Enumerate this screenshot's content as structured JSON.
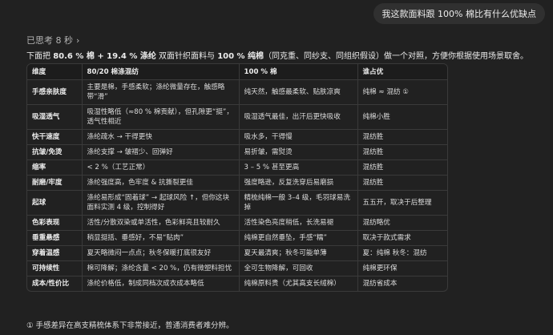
{
  "user_message": "我这款面料跟 100% 棉比有什么优缺点",
  "thought_label": "已思考 8 秒",
  "intro": {
    "prefix": "下面把 ",
    "fabric_a": "80.6 % 棉 + 19.4 % 涤纶",
    "middle": " 双面针织面料与 ",
    "fabric_b": "100 % 纯棉",
    "suffix": "（同克重、同纱支、同组织假设）做一个对照，方便你根据使用场景取舍。"
  },
  "table": {
    "headers": [
      "维度",
      "80/20 棉涤混纺",
      "100 % 棉",
      "谁占优"
    ],
    "rows": [
      [
        "手感亲肤度",
        "主要是棉，手感柔软；涤纶微量存在，触感略带“滑”",
        "纯天然，触感最柔软、贴肤凉爽",
        "纯棉 ≈ 混纺 ①"
      ],
      [
        "吸湿透气",
        "吸湿性略低（≈80 % 棉贡献），但孔隙更“挺”，透气性相近",
        "吸湿透气最佳，出汗后更快吸收",
        "纯棉小胜"
      ],
      [
        "快干速度",
        "涤纶疏水 → 干得更快",
        "吸水多，干得慢",
        "混纺胜"
      ],
      [
        "抗皱/免烫",
        "涤纶支撑 → 皱褶少、回弹好",
        "易折皱，需熨烫",
        "混纺胜"
      ],
      [
        "缩率",
        "< 2 %（工艺正常）",
        "3 – 5 % 甚至更高",
        "混纺胜"
      ],
      [
        "耐磨/牢度",
        "涤纶强度高，色牢度 & 抗撕裂更佳",
        "强度略逊，反复洗穿后易磨损",
        "混纺胜"
      ],
      [
        "起球",
        "涤纶易形成“固着球” → 起球风险 ↑，但你这块面料实测 4 级，控制得好",
        "精梳纯棉一般 3–4 级，毛羽球易洗掉",
        "五五开，取决于后整理"
      ],
      [
        "色彩表现",
        "活性/分散双染或单活性，色彩鲜亮且较耐久",
        "活性染色亮度稍低，长洗易褪",
        "混纺略优"
      ],
      [
        "垂重悬感",
        "稍显挺括、垂感好，不易“贴肉”",
        "纯棉更自然垂坠，手感“糯”",
        "取决于款式需求"
      ],
      [
        "穿着温感",
        "夏天略微闷一点点；秋冬保暖打底很友好",
        "夏天最清爽；秋冬可能单薄",
        "夏：纯棉 秋冬：混纺"
      ],
      [
        "可持续性",
        "棉可降解；涤纶含量 < 20 %，仍有微塑料担忧",
        "全可生物降解，可回收",
        "纯棉更环保"
      ],
      [
        "成本/性价比",
        "涤纶价格低，制成同档次成衣成本略低",
        "纯棉原料贵（尤其高支长绒棉）",
        "混纺省成本"
      ]
    ]
  },
  "footnote": "① 手感差异在高支精梳体系下非常接近，普通消费者难分辨。"
}
